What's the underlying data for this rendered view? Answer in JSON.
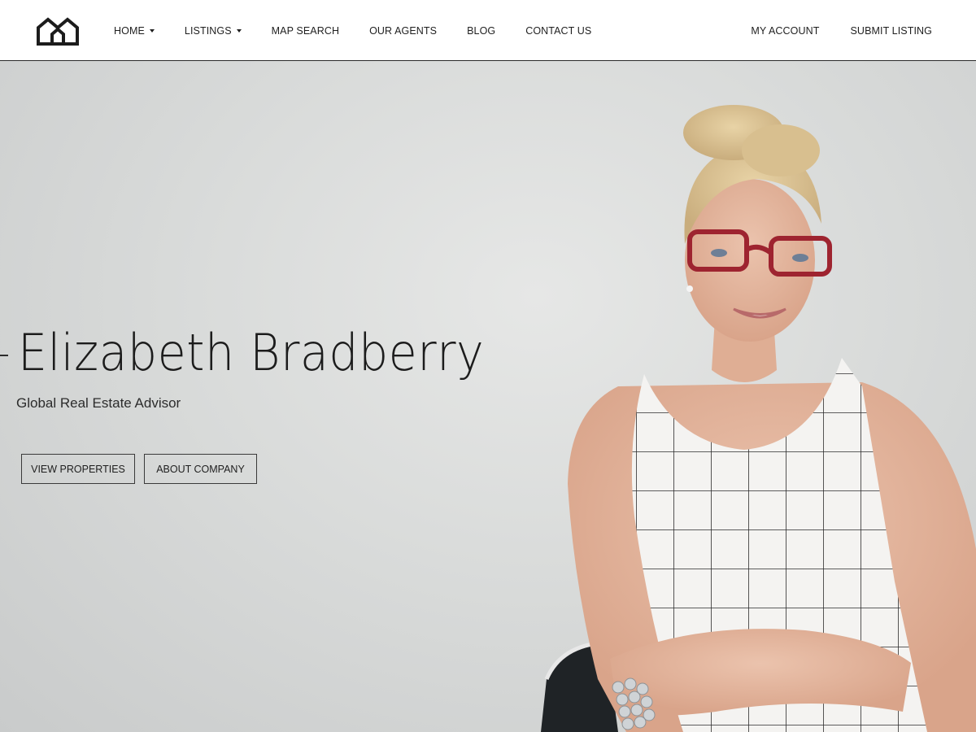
{
  "header": {
    "logo_icon": "house-outline-icon",
    "nav": [
      {
        "label": "HOME",
        "has_dropdown": true
      },
      {
        "label": "LISTINGS",
        "has_dropdown": true
      },
      {
        "label": "MAP SEARCH",
        "has_dropdown": false
      },
      {
        "label": "OUR AGENTS",
        "has_dropdown": false
      },
      {
        "label": "BLOG",
        "has_dropdown": false
      },
      {
        "label": "CONTACT US",
        "has_dropdown": false
      }
    ],
    "nav_right": [
      {
        "label": "MY ACCOUNT"
      },
      {
        "label": "SUBMIT LISTING"
      }
    ]
  },
  "hero": {
    "title": "Elizabeth Bradberry",
    "subtitle": "Global Real Estate Advisor",
    "buttons": {
      "view_properties": "VIEW PROPERTIES",
      "about_company": "ABOUT COMPANY"
    }
  },
  "colors": {
    "background": "#ffffff",
    "hero_background": "#d9dbda",
    "text": "#1c1c1c",
    "accent_glasses": "#a3232e"
  }
}
